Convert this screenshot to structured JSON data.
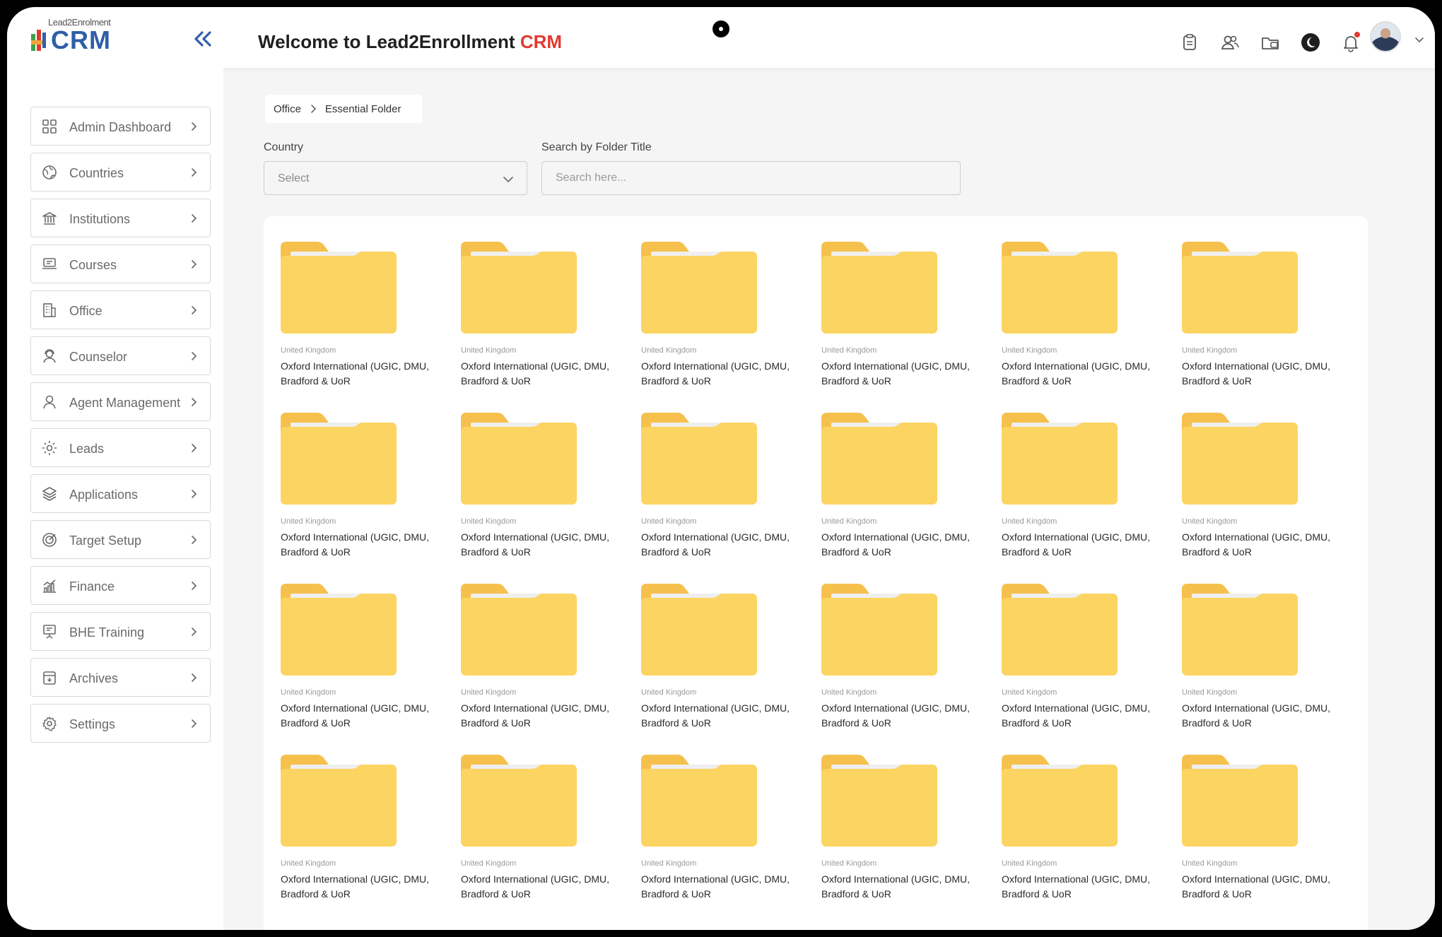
{
  "header": {
    "logo_top": "Lead2Enrolment",
    "logo_text": "CRM",
    "welcome_prefix": "Welcome to Lead2Enrollment",
    "welcome_accent": "CRM",
    "icons": [
      "clipboard-icon",
      "users-icon",
      "folder-switch-icon",
      "moon-icon",
      "bell-icon"
    ]
  },
  "sidebar": {
    "items": [
      {
        "label": "Admin Dashboard",
        "icon": "dashboard-icon"
      },
      {
        "label": "Countries",
        "icon": "globe-icon"
      },
      {
        "label": "Institutions",
        "icon": "institution-icon"
      },
      {
        "label": "Courses",
        "icon": "courses-icon"
      },
      {
        "label": "Office",
        "icon": "office-icon"
      },
      {
        "label": "Counselor",
        "icon": "counselor-icon"
      },
      {
        "label": "Agent Management",
        "icon": "agent-icon"
      },
      {
        "label": "Leads",
        "icon": "leads-icon"
      },
      {
        "label": "Applications",
        "icon": "layers-icon"
      },
      {
        "label": "Target Setup",
        "icon": "target-icon"
      },
      {
        "label": "Finance",
        "icon": "finance-icon"
      },
      {
        "label": "BHE Training",
        "icon": "training-icon"
      },
      {
        "label": "Archives",
        "icon": "archive-icon"
      },
      {
        "label": "Settings",
        "icon": "settings-icon"
      }
    ]
  },
  "breadcrumb": [
    "Office",
    "Essential Folder"
  ],
  "filters": {
    "country_label": "Country",
    "country_value": "Select",
    "search_label": "Search by Folder Title",
    "search_placeholder": "Search here..."
  },
  "folders": [
    {
      "country": "United Kingdom",
      "line1": "Oxford International (UGIC, DMU,",
      "line2": "Bradford & UoR"
    },
    {
      "country": "United Kingdom",
      "line1": "Oxford International (UGIC, DMU,",
      "line2": "Bradford & UoR"
    },
    {
      "country": "United Kingdom",
      "line1": "Oxford International (UGIC, DMU,",
      "line2": "Bradford & UoR"
    },
    {
      "country": "United Kingdom",
      "line1": "Oxford International (UGIC, DMU,",
      "line2": "Bradford & UoR"
    },
    {
      "country": "United Kingdom",
      "line1": "Oxford International (UGIC, DMU,",
      "line2": "Bradford & UoR"
    },
    {
      "country": "United Kingdom",
      "line1": "Oxford International (UGIC, DMU,",
      "line2": "Bradford & UoR"
    },
    {
      "country": "United Kingdom",
      "line1": "Oxford International (UGIC, DMU,",
      "line2": "Bradford & UoR"
    },
    {
      "country": "United Kingdom",
      "line1": "Oxford International (UGIC, DMU,",
      "line2": "Bradford & UoR"
    },
    {
      "country": "United Kingdom",
      "line1": "Oxford International (UGIC, DMU,",
      "line2": "Bradford & UoR"
    },
    {
      "country": "United Kingdom",
      "line1": "Oxford International (UGIC, DMU,",
      "line2": "Bradford & UoR"
    },
    {
      "country": "United Kingdom",
      "line1": "Oxford International (UGIC, DMU,",
      "line2": "Bradford & UoR"
    },
    {
      "country": "United Kingdom",
      "line1": "Oxford International (UGIC, DMU,",
      "line2": "Bradford & UoR"
    },
    {
      "country": "United Kingdom",
      "line1": "Oxford International (UGIC, DMU,",
      "line2": "Bradford & UoR"
    },
    {
      "country": "United Kingdom",
      "line1": "Oxford International (UGIC, DMU,",
      "line2": "Bradford & UoR"
    },
    {
      "country": "United Kingdom",
      "line1": "Oxford International (UGIC, DMU,",
      "line2": "Bradford & UoR"
    },
    {
      "country": "United Kingdom",
      "line1": "Oxford International (UGIC, DMU,",
      "line2": "Bradford & UoR"
    },
    {
      "country": "United Kingdom",
      "line1": "Oxford International (UGIC, DMU,",
      "line2": "Bradford & UoR"
    },
    {
      "country": "United Kingdom",
      "line1": "Oxford International (UGIC, DMU,",
      "line2": "Bradford & UoR"
    },
    {
      "country": "United Kingdom",
      "line1": "Oxford International (UGIC, DMU,",
      "line2": "Bradford & UoR"
    },
    {
      "country": "United Kingdom",
      "line1": "Oxford International (UGIC, DMU,",
      "line2": "Bradford & UoR"
    },
    {
      "country": "United Kingdom",
      "line1": "Oxford International (UGIC, DMU,",
      "line2": "Bradford & UoR"
    },
    {
      "country": "United Kingdom",
      "line1": "Oxford International (UGIC, DMU,",
      "line2": "Bradford & UoR"
    },
    {
      "country": "United Kingdom",
      "line1": "Oxford International (UGIC, DMU,",
      "line2": "Bradford & UoR"
    },
    {
      "country": "United Kingdom",
      "line1": "Oxford International (UGIC, DMU,",
      "line2": "Bradford & UoR"
    }
  ],
  "colors": {
    "brand_blue": "#2f5fa8",
    "accent_red": "#e03a2f",
    "folder_front": "#fcd462",
    "folder_back": "#f6c04d"
  }
}
